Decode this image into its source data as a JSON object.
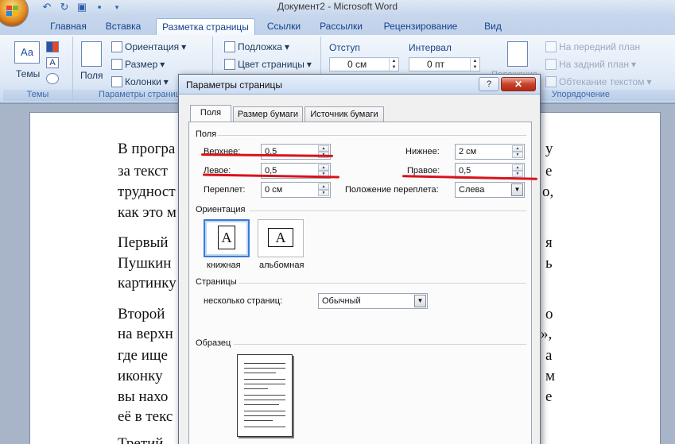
{
  "app": {
    "title": "Документ2 - Microsoft Word"
  },
  "tabs": [
    {
      "label": "Главная"
    },
    {
      "label": "Вставка"
    },
    {
      "label": "Разметка страницы",
      "active": true
    },
    {
      "label": "Ссылки"
    },
    {
      "label": "Рассылки"
    },
    {
      "label": "Рецензирование"
    },
    {
      "label": "Вид"
    }
  ],
  "ribbon": {
    "themes": {
      "label": "Темы",
      "group": "Темы"
    },
    "page_setup": {
      "group": "Параметры страницы",
      "fields": "Поля",
      "orientation": "Ориентация",
      "size": "Размер",
      "columns": "Колонки"
    },
    "background": {
      "watermark": "Подложка",
      "page_color": "Цвет страницы"
    },
    "paragraph": {
      "indent": "Отступ",
      "indent_value": "0 см",
      "spacing": "Интервал",
      "spacing_value": "0 пт"
    },
    "arrange": {
      "group": "Упорядочение",
      "bring_front": "На передний план",
      "send_back": "На задний план",
      "wrap": "Обтекание текстом",
      "position": "Положение"
    }
  },
  "document": {
    "lines": [
      "В програ",
      "за  текст",
      "трудност",
      "как это м",
      "Первый",
      "Пушкин",
      "картинку",
      "Второй",
      "на верхн",
      "где   ище",
      "иконку",
      "вы нахо",
      "её в текс",
      "Третий"
    ],
    "right_fragments": [
      "у",
      "е",
      "о,",
      "я",
      "ь",
      "о",
      "»,",
      "а",
      "м",
      "е"
    ]
  },
  "dialog": {
    "title": "Параметры страницы",
    "help": "?",
    "close": "✕",
    "tabs": [
      "Поля",
      "Размер бумаги",
      "Источник бумаги"
    ],
    "margins_section": "Поля",
    "top_label": "Верхнее:",
    "top_value": "0,5",
    "bottom_label": "Нижнее:",
    "bottom_value": "2 см",
    "left_label": "Левое:",
    "left_value": "0,5",
    "right_label": "Правое:",
    "right_value": "0,5",
    "gutter_label": "Переплет:",
    "gutter_value": "0 см",
    "gutter_pos_label": "Положение переплета:",
    "gutter_pos_value": "Слева",
    "orientation_section": "Ориентация",
    "portrait": "книжная",
    "landscape": "альбомная",
    "pages_section": "Страницы",
    "multiple_pages_label": "несколько страниц:",
    "multiple_pages_value": "Обычный",
    "preview_section": "Образец"
  }
}
